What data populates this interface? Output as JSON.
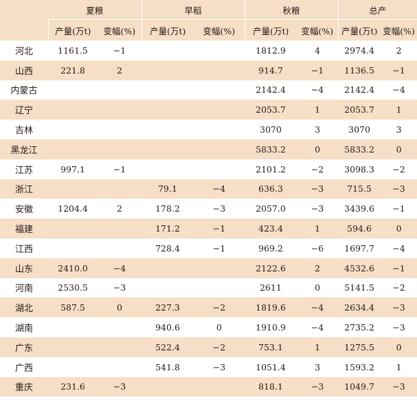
{
  "table": {
    "group_headers": [
      "夏粮",
      "早稻",
      "秋粮",
      "总产"
    ],
    "sub_headers": [
      "产量(万t)",
      "变幅(%)"
    ],
    "rows": [
      {
        "province": "河北",
        "cells": [
          "1161.5",
          "−1",
          "",
          "",
          "1812.9",
          "4",
          "2974.4",
          "2"
        ]
      },
      {
        "province": "山西",
        "cells": [
          "221.8",
          "2",
          "",
          "",
          "914.7",
          "−1",
          "1136.5",
          "−1"
        ]
      },
      {
        "province": "内蒙古",
        "cells": [
          "",
          "",
          "",
          "",
          "2142.4",
          "−4",
          "2142.4",
          "−4"
        ]
      },
      {
        "province": "辽宁",
        "cells": [
          "",
          "",
          "",
          "",
          "2053.7",
          "1",
          "2053.7",
          "1"
        ]
      },
      {
        "province": "吉林",
        "cells": [
          "",
          "",
          "",
          "",
          "3070",
          "3",
          "3070",
          "3"
        ]
      },
      {
        "province": "黑龙江",
        "cells": [
          "",
          "",
          "",
          "",
          "5833.2",
          "0",
          "5833.2",
          "0"
        ]
      },
      {
        "province": "江苏",
        "cells": [
          "997.1",
          "−1",
          "",
          "",
          "2101.2",
          "−2",
          "3098.3",
          "−2"
        ]
      },
      {
        "province": "浙江",
        "cells": [
          "",
          "",
          "79.1",
          "−4",
          "636.3",
          "−3",
          "715.5",
          "−3"
        ]
      },
      {
        "province": "安徽",
        "cells": [
          "1204.4",
          "2",
          "178.2",
          "−3",
          "2057.0",
          "−3",
          "3439.6",
          "−1"
        ]
      },
      {
        "province": "福建",
        "cells": [
          "",
          "",
          "171.2",
          "−1",
          "423.4",
          "1",
          "594.6",
          "0"
        ]
      },
      {
        "province": "江西",
        "cells": [
          "",
          "",
          "728.4",
          "−1",
          "969.2",
          "−6",
          "1697.7",
          "−4"
        ]
      },
      {
        "province": "山东",
        "cells": [
          "2410.0",
          "−4",
          "",
          "",
          "2122.6",
          "2",
          "4532.6",
          "−1"
        ]
      },
      {
        "province": "河南",
        "cells": [
          "2530.5",
          "−3",
          "",
          "",
          "2611",
          "0",
          "5141.5",
          "−2"
        ]
      },
      {
        "province": "湖北",
        "cells": [
          "587.5",
          "0",
          "227.3",
          "−2",
          "1819.6",
          "−4",
          "2634.4",
          "−3"
        ]
      },
      {
        "province": "湖南",
        "cells": [
          "",
          "",
          "940.6",
          "0",
          "1910.9",
          "−4",
          "2735.2",
          "−3"
        ]
      },
      {
        "province": "广东",
        "cells": [
          "",
          "",
          "522.4",
          "−2",
          "753.1",
          "1",
          "1275.5",
          "0"
        ]
      },
      {
        "province": "广西",
        "cells": [
          "",
          "",
          "541.8",
          "−3",
          "1051.4",
          "3",
          "1593.2",
          "1"
        ]
      },
      {
        "province": "重庆",
        "cells": [
          "231.6",
          "−3",
          "",
          "",
          "818.1",
          "−3",
          "1049.7",
          "−3"
        ]
      }
    ]
  }
}
